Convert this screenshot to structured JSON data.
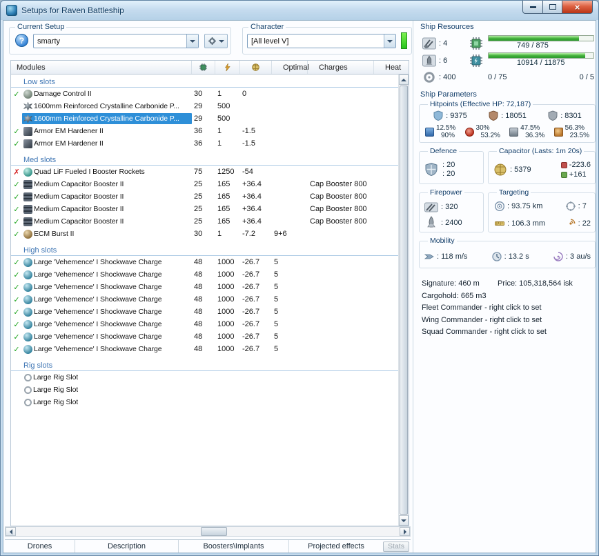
{
  "window": {
    "title": "Setups for Raven Battleship"
  },
  "icons": {
    "check": "✓",
    "cross": "✗",
    "close": "×",
    "help": "?"
  },
  "toolbar": {
    "current_setup": {
      "label": "Current Setup",
      "value": "smarty"
    },
    "character": {
      "label": "Character",
      "value": "[All level V]"
    }
  },
  "table": {
    "headers": {
      "modules": "Modules",
      "optimal": "Optimal",
      "charges": "Charges",
      "heat": "Heat"
    },
    "sections": [
      {
        "name": "Low slots",
        "rows": [
          {
            "status": "ok",
            "icon": "damage-control",
            "name": "Damage Control II",
            "cpu": "30",
            "pg": "1",
            "cap": "0",
            "optimal": "",
            "charges": "",
            "selected": false
          },
          {
            "status": "",
            "icon": "plate",
            "name": "1600mm Reinforced Crystalline Carbonide P...",
            "cpu": "29",
            "pg": "500",
            "cap": "",
            "optimal": "",
            "charges": "",
            "selected": false
          },
          {
            "status": "",
            "icon": "plate",
            "name": "1600mm Reinforced Crystalline Carbonide P...",
            "cpu": "29",
            "pg": "500",
            "cap": "",
            "optimal": "",
            "charges": "",
            "selected": true
          },
          {
            "status": "ok",
            "icon": "hardener",
            "name": "Armor EM Hardener II",
            "cpu": "36",
            "pg": "1",
            "cap": "-1.5",
            "optimal": "",
            "charges": "",
            "selected": false
          },
          {
            "status": "ok",
            "icon": "hardener",
            "name": "Armor EM Hardener II",
            "cpu": "36",
            "pg": "1",
            "cap": "-1.5",
            "optimal": "",
            "charges": "",
            "selected": false
          }
        ]
      },
      {
        "name": "Med slots",
        "rows": [
          {
            "status": "error",
            "icon": "booster-rockets",
            "name": "Quad LiF Fueled I Booster Rockets",
            "cpu": "75",
            "pg": "1250",
            "cap": "-54",
            "optimal": "",
            "charges": "",
            "selected": false
          },
          {
            "status": "ok",
            "icon": "cap-booster",
            "name": "Medium Capacitor Booster II",
            "cpu": "25",
            "pg": "165",
            "cap": "+36.4",
            "optimal": "",
            "charges": "Cap Booster 800",
            "selected": false
          },
          {
            "status": "ok",
            "icon": "cap-booster",
            "name": "Medium Capacitor Booster II",
            "cpu": "25",
            "pg": "165",
            "cap": "+36.4",
            "optimal": "",
            "charges": "Cap Booster 800",
            "selected": false
          },
          {
            "status": "ok",
            "icon": "cap-booster",
            "name": "Medium Capacitor Booster II",
            "cpu": "25",
            "pg": "165",
            "cap": "+36.4",
            "optimal": "",
            "charges": "Cap Booster 800",
            "selected": false
          },
          {
            "status": "ok",
            "icon": "cap-booster",
            "name": "Medium Capacitor Booster II",
            "cpu": "25",
            "pg": "165",
            "cap": "+36.4",
            "optimal": "",
            "charges": "Cap Booster 800",
            "selected": false
          },
          {
            "status": "ok",
            "icon": "ecm-burst",
            "name": "ECM Burst II",
            "cpu": "30",
            "pg": "1",
            "cap": "-7.2",
            "optimal": "9+6",
            "charges": "",
            "selected": false
          }
        ]
      },
      {
        "name": "High slots",
        "rows": [
          {
            "status": "ok",
            "icon": "charge",
            "name": "Large 'Vehemence' I Shockwave Charge",
            "cpu": "48",
            "pg": "1000",
            "cap": "-26.7",
            "optimal": "5",
            "charges": "",
            "selected": false
          },
          {
            "status": "ok",
            "icon": "charge",
            "name": "Large 'Vehemence' I Shockwave Charge",
            "cpu": "48",
            "pg": "1000",
            "cap": "-26.7",
            "optimal": "5",
            "charges": "",
            "selected": false
          },
          {
            "status": "ok",
            "icon": "charge",
            "name": "Large 'Vehemence' I Shockwave Charge",
            "cpu": "48",
            "pg": "1000",
            "cap": "-26.7",
            "optimal": "5",
            "charges": "",
            "selected": false
          },
          {
            "status": "ok",
            "icon": "charge",
            "name": "Large 'Vehemence' I Shockwave Charge",
            "cpu": "48",
            "pg": "1000",
            "cap": "-26.7",
            "optimal": "5",
            "charges": "",
            "selected": false
          },
          {
            "status": "ok",
            "icon": "charge",
            "name": "Large 'Vehemence' I Shockwave Charge",
            "cpu": "48",
            "pg": "1000",
            "cap": "-26.7",
            "optimal": "5",
            "charges": "",
            "selected": false
          },
          {
            "status": "ok",
            "icon": "charge",
            "name": "Large 'Vehemence' I Shockwave Charge",
            "cpu": "48",
            "pg": "1000",
            "cap": "-26.7",
            "optimal": "5",
            "charges": "",
            "selected": false
          },
          {
            "status": "ok",
            "icon": "charge",
            "name": "Large 'Vehemence' I Shockwave Charge",
            "cpu": "48",
            "pg": "1000",
            "cap": "-26.7",
            "optimal": "5",
            "charges": "",
            "selected": false
          },
          {
            "status": "ok",
            "icon": "charge",
            "name": "Large 'Vehemence' I Shockwave Charge",
            "cpu": "48",
            "pg": "1000",
            "cap": "-26.7",
            "optimal": "5",
            "charges": "",
            "selected": false
          }
        ]
      },
      {
        "name": "Rig slots",
        "rows": [
          {
            "status": "",
            "icon": "rig",
            "name": "Large Rig Slot",
            "cpu": "",
            "pg": "",
            "cap": "",
            "optimal": "",
            "charges": "",
            "selected": false
          },
          {
            "status": "",
            "icon": "rig",
            "name": "Large Rig Slot",
            "cpu": "",
            "pg": "",
            "cap": "",
            "optimal": "",
            "charges": "",
            "selected": false
          },
          {
            "status": "",
            "icon": "rig",
            "name": "Large Rig Slot",
            "cpu": "",
            "pg": "",
            "cap": "",
            "optimal": "",
            "charges": "",
            "selected": false
          }
        ]
      }
    ]
  },
  "resources": {
    "title": "Ship Resources",
    "turrets": ": 4",
    "launchers": ": 6",
    "calibration": ": 400",
    "cpu_text": "749 / 875",
    "cpu_pct": 86,
    "pg_text": "10914 / 11875",
    "pg_pct": 92,
    "drones": "0 / 75",
    "rigs": "0 / 5"
  },
  "parameters": {
    "title": "Ship Parameters",
    "hitpoints": {
      "label": "Hitpoints (Effective HP: 72,187)",
      "shield": ": 9375",
      "armor": ": 18051",
      "hull": ": 8301",
      "resists": [
        {
          "name": "em",
          "shield": "12.5%",
          "armor": "90%"
        },
        {
          "name": "thermal",
          "shield": "30%",
          "armor": "53.2%"
        },
        {
          "name": "kinetic",
          "shield": "47.5%",
          "armor": "36.3%"
        },
        {
          "name": "explosive",
          "shield": "56.3%",
          "armor": "23.5%"
        }
      ]
    },
    "defence": {
      "label": "Defence",
      "value1": ": 20",
      "value2": ": 20"
    },
    "capacitor": {
      "label": "Capacitor (Lasts: 1m 20s)",
      "amount": ": 5379",
      "drain": "-223.6",
      "boost": "+161"
    },
    "firepower": {
      "label": "Firepower",
      "turret": ": 320",
      "missile": ": 2400"
    },
    "targeting": {
      "label": "Targeting",
      "range": ": 93.75 km",
      "max_targets": ": 7",
      "scan_resolution": ": 106.3 mm",
      "sensor_strength": ": 22"
    },
    "mobility": {
      "label": "Mobility",
      "speed": ": 118 m/s",
      "align": ": 13.2 s",
      "warp": ": 3 au/s"
    },
    "summary": {
      "signature": "Signature: 460 m",
      "price": "Price: 105,318,564 isk",
      "cargohold": "Cargohold: 665 m3",
      "fleet": "Fleet Commander - right click to set",
      "wing": "Wing Commander - right click to set",
      "squad": "Squad Commander - right click to set"
    }
  },
  "bottom": {
    "tabs": [
      "Drones",
      "Description",
      "Boosters\\Implants",
      "Projected effects"
    ],
    "stats": "Stats"
  }
}
